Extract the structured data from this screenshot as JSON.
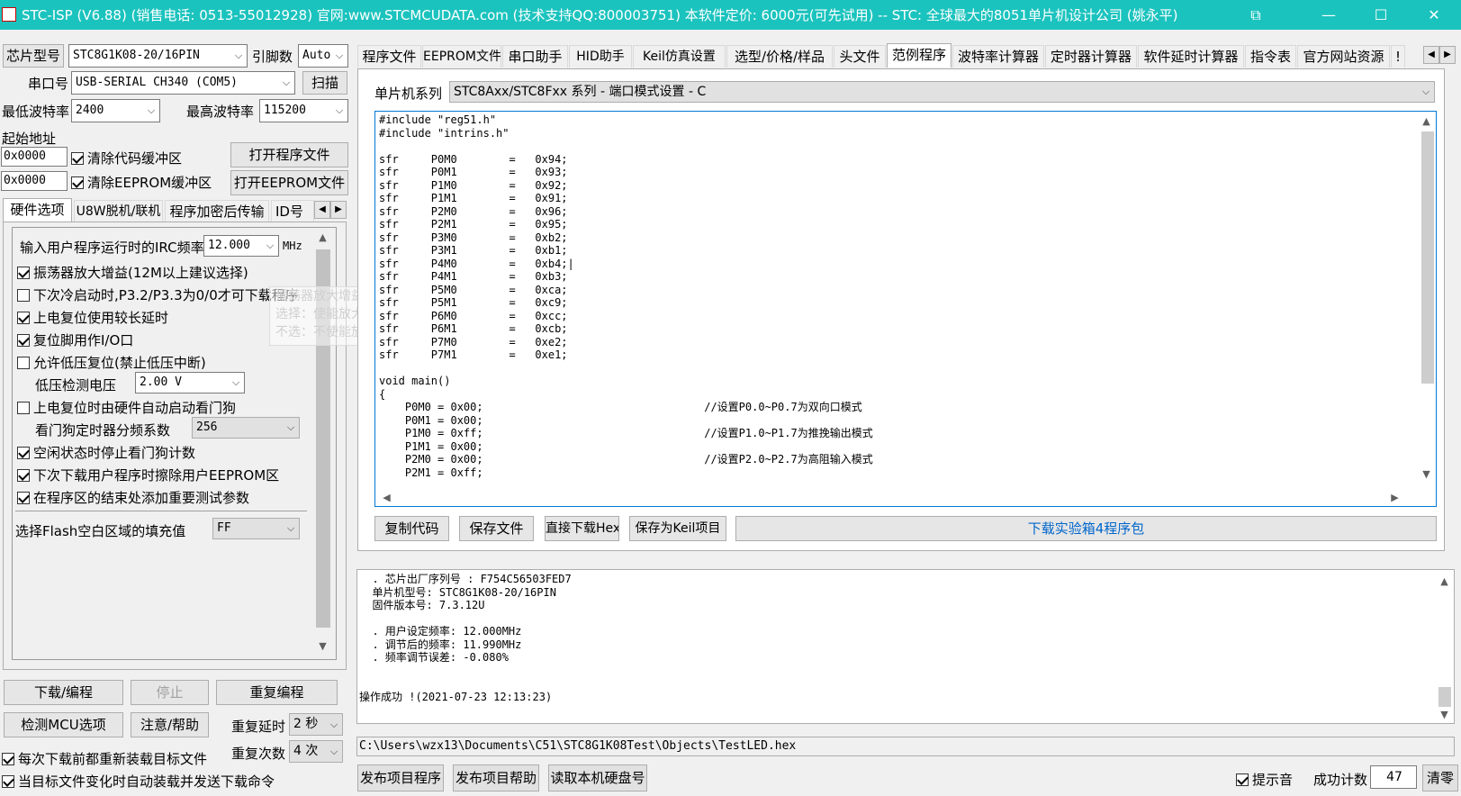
{
  "titlebar": {
    "title": "STC-ISP (V6.88) (销售电话: 0513-55012928) 官网:www.STCMCUDATA.com  (技术支持QQ:800003751) 本软件定价: 6000元(可先试用) -- STC: 全球最大的8051单片机设计公司 (姚永平)",
    "restore_label": "⧉",
    "minimize_label": "—",
    "maximize_label": "☐",
    "close_label": "✕"
  },
  "left": {
    "chip_model_btn": "芯片型号",
    "chip_model_value": "STC8G1K08-20/16PIN",
    "pin_count_label": "引脚数",
    "pin_count_value": "Auto",
    "serial_port_label": "串口号",
    "serial_port_value": "USB-SERIAL CH340 (COM5)",
    "scan_btn": "扫描",
    "min_baud_label": "最低波特率",
    "min_baud_value": "2400",
    "max_baud_label": "最高波特率",
    "max_baud_value": "115200",
    "start_addr_label": "起始地址",
    "code_addr": "0x0000",
    "clear_code_buffer": "清除代码缓冲区",
    "open_program_btn": "打开程序文件",
    "eeprom_addr": "0x0000",
    "clear_eeprom_buffer": "清除EEPROM缓冲区",
    "open_eeprom_btn": "打开EEPROM文件",
    "tabs": [
      "硬件选项",
      "U8W脱机/联机",
      "程序加密后传输",
      "ID号"
    ],
    "hw": {
      "irc_label": "输入用户程序运行时的IRC频率",
      "irc_value": "12.000",
      "irc_unit": "MHz",
      "opt1": "振荡器放大增益(12M以上建议选择)",
      "opt2": "下次冷启动时,P3.2/P3.3为0/0才可下载程序",
      "opt3": "上电复位使用较长延时",
      "opt4": "复位脚用作I/O口",
      "opt5": "允许低压复位(禁止低压中断)",
      "lvd_label": "低压检测电压",
      "lvd_value": "2.00 V",
      "opt6": "上电复位时由硬件自动启动看门狗",
      "wdt_label": "看门狗定时器分频系数",
      "wdt_value": "256",
      "opt7": "空闲状态时停止看门狗计数",
      "opt8": "下次下载用户程序时擦除用户EEPROM区",
      "opt9": "在程序区的结束处添加重要测试参数",
      "fill_label": "选择Flash空白区域的填充值",
      "fill_value": "FF",
      "tooltip_l1": "振荡器放大增益",
      "tooltip_l2": "选择：使能放大增益",
      "tooltip_l3": "不选：不使能放大增益"
    },
    "download_btn": "下载/编程",
    "stop_btn": "停止",
    "reprogram_btn": "重复编程",
    "check_mcu_btn": "检测MCU选项",
    "help_btn": "注意/帮助",
    "repeat_delay_label": "重复延时",
    "repeat_delay_value": "2 秒",
    "repeat_count_label": "重复次数",
    "repeat_count_value": "4 次",
    "reload_before_dl": "每次下载前都重新装载目标文件",
    "auto_reload": "当目标文件变化时自动装载并发送下载命令"
  },
  "right": {
    "tabs": [
      "程序文件",
      "EEPROM文件",
      "串口助手",
      "HID助手",
      "Keil仿真设置",
      "选型/价格/样品",
      "头文件",
      "范例程序",
      "波特率计算器",
      "定时器计算器",
      "软件延时计算器",
      "指令表",
      "官方网站资源",
      "!"
    ],
    "series_label": "单片机系列",
    "series_value": "STC8Axx/STC8Fxx 系列 - 端口模式设置 - C",
    "code_lines": [
      "#include \"reg51.h\"",
      "#include \"intrins.h\"",
      "",
      "sfr     P0M0        =   0x94;",
      "sfr     P0M1        =   0x93;",
      "sfr     P1M0        =   0x92;",
      "sfr     P1M1        =   0x91;",
      "sfr     P2M0        =   0x96;",
      "sfr     P2M1        =   0x95;",
      "sfr     P3M0        =   0xb2;",
      "sfr     P3M1        =   0xb1;",
      "sfr     P4M0        =   0xb4;|",
      "sfr     P4M1        =   0xb3;",
      "sfr     P5M0        =   0xca;",
      "sfr     P5M1        =   0xc9;",
      "sfr     P6M0        =   0xcc;",
      "sfr     P6M1        =   0xcb;",
      "sfr     P7M0        =   0xe2;",
      "sfr     P7M1        =   0xe1;",
      "",
      "void main()",
      "{",
      "    P0M0 = 0x00;                                  //设置P0.0~P0.7为双向口模式",
      "    P0M1 = 0x00;",
      "    P1M0 = 0xff;                                  //设置P1.0~P1.7为推挽输出模式",
      "    P1M1 = 0x00;",
      "    P2M0 = 0x00;                                  //设置P2.0~P2.7为高阻输入模式",
      "    P2M1 = 0xff;"
    ],
    "copy_code_btn": "复制代码",
    "save_file_btn": "保存文件",
    "direct_dl_btn": "直接下载Hex",
    "save_keil_btn": "保存为Keil项目",
    "dl_package_btn": "下载实验箱4程序包",
    "log_lines": [
      "  . 芯片出厂序列号 : F754C56503FED7",
      "  单片机型号: STC8G1K08-20/16PIN",
      "  固件版本号: 7.3.12U",
      "",
      "  . 用户设定频率: 12.000MHz",
      "  . 调节后的频率: 11.990MHz",
      "  . 频率调节误差: -0.080%",
      "",
      "",
      "操作成功 !(2021-07-23 12:13:23)"
    ],
    "file_path": "C:\\Users\\wzx13\\Documents\\C51\\STC8G1K08Test\\Objects\\TestLED.hex",
    "publish_btn": "发布项目程序",
    "publish_help_btn": "发布项目帮助",
    "read_disk_btn": "读取本机硬盘号",
    "beep_label": "提示音",
    "success_count_label": "成功计数",
    "success_count_value": "47",
    "clear_btn": "清零"
  }
}
